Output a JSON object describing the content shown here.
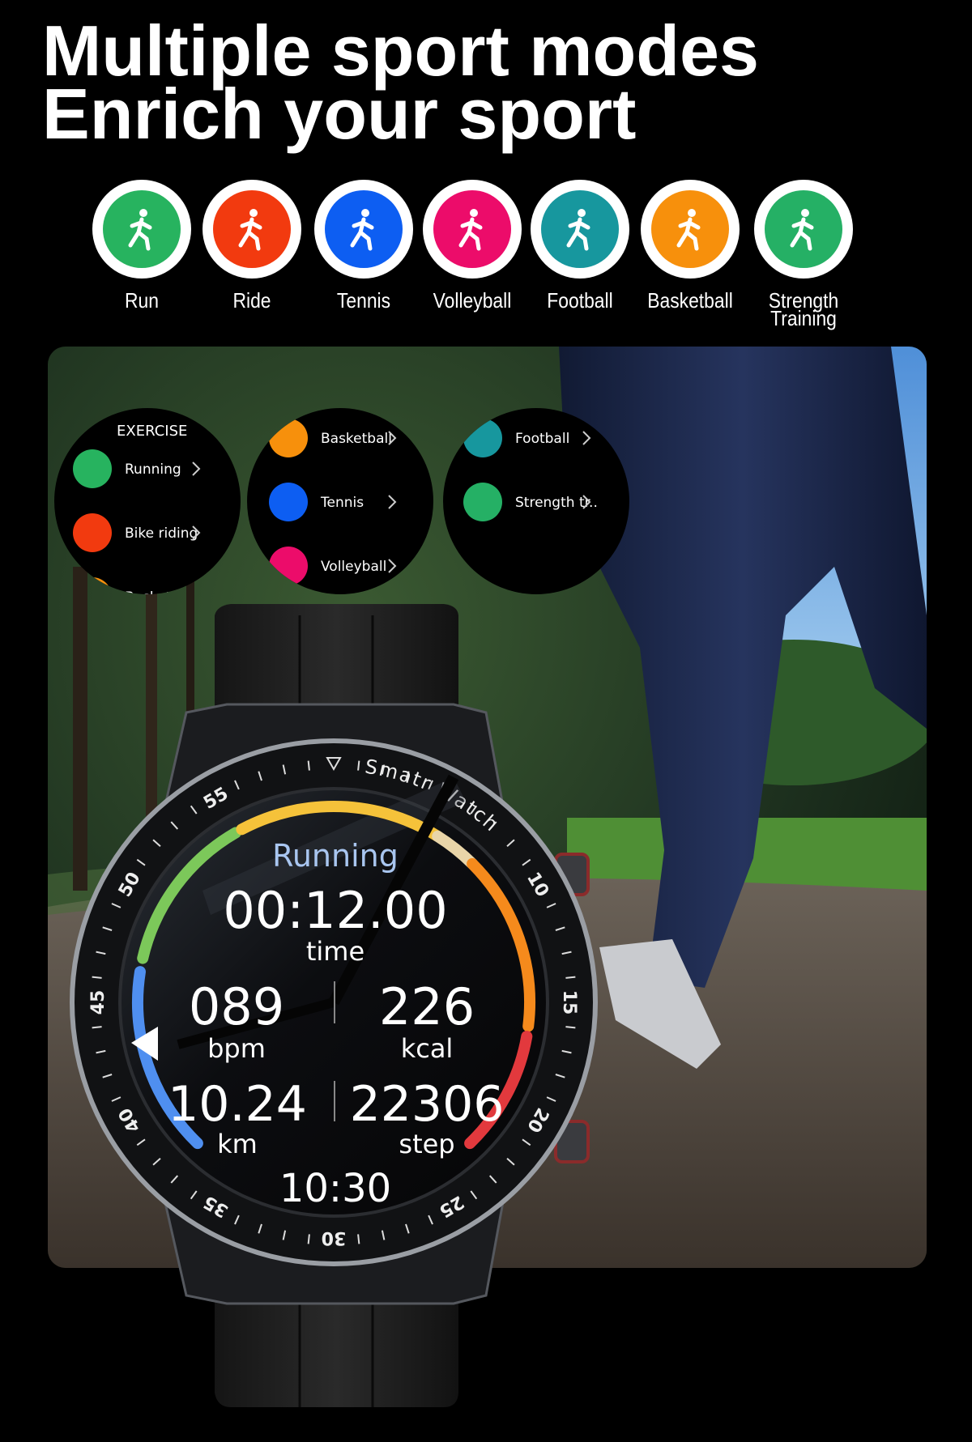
{
  "headline": {
    "line1": "Multiple sport modes",
    "line2": "Enrich your sport"
  },
  "modes": [
    {
      "label": "Run",
      "icon": "running-icon",
      "color": "#27b35f"
    },
    {
      "label": "Ride",
      "icon": "cycling-icon",
      "color": "#f23a0f"
    },
    {
      "label": "Tennis",
      "icon": "tennis-icon",
      "color": "#0d5ef2"
    },
    {
      "label": "Volleyball",
      "icon": "volleyball-icon",
      "color": "#ec0c6a"
    },
    {
      "label": "Football",
      "icon": "football-icon",
      "color": "#17979e"
    },
    {
      "label": "Basketball",
      "icon": "basketball-icon",
      "color": "#f7900c"
    },
    {
      "label": "Strength Training",
      "icon": "weightlifting-icon",
      "color": "#25b065"
    }
  ],
  "menus": [
    {
      "header": "EXERCISE",
      "items": [
        {
          "label": "Running",
          "color": "#27b35f"
        },
        {
          "label": "Bike riding",
          "color": "#f23a0f"
        },
        {
          "label": "Basketl",
          "color": "#f7900c"
        }
      ]
    },
    {
      "items": [
        {
          "label": "Basketball",
          "color": "#f7900c"
        },
        {
          "label": "Tennis",
          "color": "#0d5ef2"
        },
        {
          "label": "Volleyball",
          "color": "#ec0c6a"
        }
      ]
    },
    {
      "items": [
        {
          "label": "Football",
          "color": "#17979e"
        },
        {
          "label": "Strength tr..",
          "color": "#25b065"
        }
      ]
    }
  ],
  "watch": {
    "brand": "Smatr Watch",
    "mode": "Running",
    "timer": "00:12.00",
    "timer_unit": "time",
    "heart_rate": "089",
    "heart_rate_unit": "bpm",
    "calories": "226",
    "calories_unit": "kcal",
    "distance": "10.24",
    "distance_unit": "km",
    "steps": "22306",
    "steps_unit": "step",
    "clock": "10:30",
    "bezel_numbers": [
      "10",
      "15",
      "20",
      "25",
      "30",
      "35",
      "40",
      "45",
      "50",
      "55"
    ],
    "arc_colors": [
      "#4f8ff0",
      "#7cc85a",
      "#f5c23a",
      "#e9d5a8",
      "#f58a1c",
      "#e2393d"
    ],
    "accent": "#a9c6f0"
  }
}
